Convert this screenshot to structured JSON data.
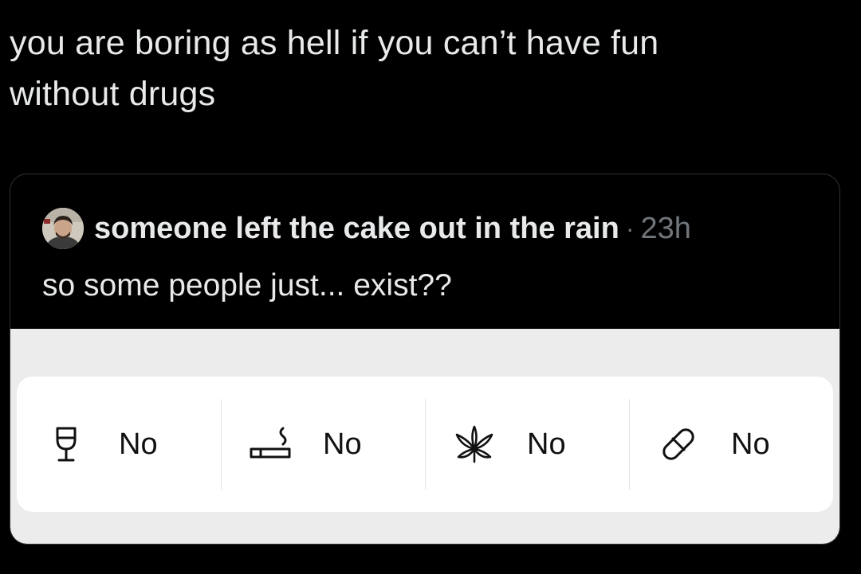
{
  "tweet": {
    "text_line1": "you are boring as hell if you can’t have fun",
    "text_line2": "without drugs"
  },
  "quote": {
    "author": "someone left the cake out in the rain",
    "separator": "·",
    "time": "23h",
    "text": "so some people just... exist??"
  },
  "habits": [
    {
      "icon": "wine-glass-icon",
      "value": "No"
    },
    {
      "icon": "cigarette-icon",
      "value": "No"
    },
    {
      "icon": "cannabis-leaf-icon",
      "value": "No"
    },
    {
      "icon": "pill-icon",
      "value": "No"
    }
  ],
  "colors": {
    "background": "#000000",
    "text": "#e7e9ea",
    "muted": "#71767b",
    "card_border": "#2f3336",
    "media_bg": "#ececec",
    "panel_bg": "#ffffff"
  }
}
